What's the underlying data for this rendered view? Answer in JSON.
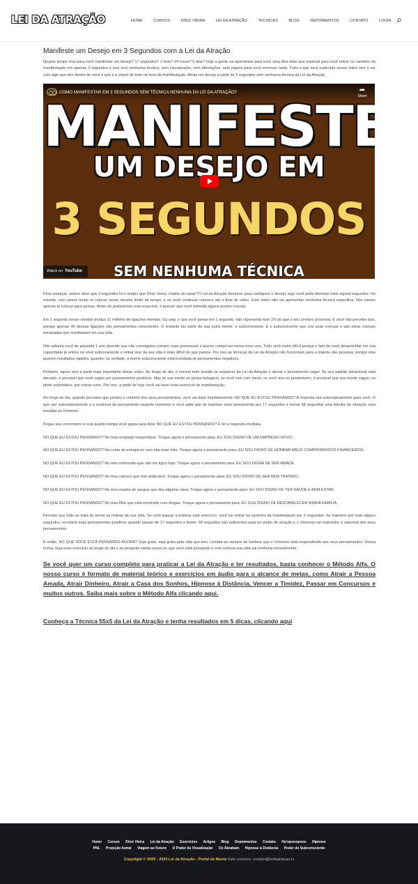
{
  "header": {
    "logo": "LEI DA ATRAÇÃO",
    "nav": [
      "Home",
      "CURSOS",
      "DINIZ VIEIRA",
      "LEI DA ATRAÇÃO",
      "TECNICAS",
      "BLOG",
      "DEPOIMENTOS",
      "CONTATO",
      "LOGIN"
    ]
  },
  "post": {
    "title": "Manifeste um Desejo em 3 Segundos com a Lei da Atração",
    "intro": "Quanto tempo leva para você manifestar um desejo? 17 segundos? 1 hora? 24 horas? 5 dias? Hoje a gente vai apresentar para você uma dica mais que especial para você entrar no caminho da manifestação em apenas 3 segundos e isso sem nenhuma técnica, sem visualização, sem afirmações, sem papeis para você escrever nada. Tudo o que será explicado nesse vídeo tem a ver com algo que tem dentro de você e que é a chave de tudo na hora da manifestação. Atraia um desejo a partir de 3 segundos sem nenhuma técnica da Lei da Atração.",
    "video": {
      "title": "COMO MANIFESTAR EM 3 SEGUNDOS SEM TÉCNICA NENHUMA DA LEI DA ATRAÇÃO?",
      "share_label": "Share",
      "thumb_line1": "MANIFESTE",
      "thumb_line2": "UM DESEJO EM",
      "thumb_line3": "3 SEGUNDOS",
      "thumb_line4": "SEM NENHUMA TÉCNICA",
      "watch_on": "Watch on",
      "youtube": "YouTube"
    },
    "paragraphs": [
      "Para começar, vamos dizer que 3 segundos foi o tempo que Diniz Vieira, criador do canal TV Lei da Atração demorou para configurar o desejo, logo você pode demorar mais alguns segundos. No entanto, nós vamos tentar te colocar nesse mesmo limite de tempo, e só você continuar conosco até o final do vídeo. Este vídeo não vai apresentar nenhuma técnica especifica. Nós vamos apenas te colocar para pensar. Antes de praticarmos este exercício, é preciso que você entenda alguns pontos cruciais.",
      "Em 1 segundo nosso cérebro produz 11 milhões de ligações mentais. Ou seja, o que você pensa em 1 segundo, não representa nem 1% do que o seu cérebro processa. E você não percebe isso, porque apenas 40 dessas ligações são pensamentos conscientes. O restante faz parte da sua outra mente: o subconsciente. É o subconsciente que cria suas crenças e são estas crenças enraizadas que manifestam em sua vida.",
      "Não adianta você ter passado 1 ano dizendo que não conseguiria cumprir suas promessas e querer cumpri-las nesse novo ano. Tudo será muito difícil porque o fato de você desacreditar em sua capacidade já entrou no nível subconsciente e retirar isso da sua vida é mais difícil do que parece. Por isso as técnicas da Lei da Atração não funcionam para a maioria das pessoas, porque elas querem resultados rápidos, quando, na verdade, a mente subconsciente está inundada de pensamentos negativos.",
      "Portanto, agora vem a parte mais importante desse vídeo. Ao longo do dia, é normal todo mundo se esquecer da Lei da Atração e deixar o pensamento vagar. Se seu padrão vibracional está elevado, é provável que você vague por pensamentos positivos. Mas se sua mente só pensa bobagem, se você vive com medo, se você vive no pessimismo, é provável que sua mente vague, no piloto automático, por coisas ruins. Por isso, a partir de hoje você vai fazer esse exercício de manifestação:",
      "Ao longo do dia, quando perceber que perdeu o controlo dos seus pensamentos, você vai dizer imediatamente: NO QUE EU ESTOU PENSANDO? A resposta virá automaticamente para você. O que vier automaticamente é a essência do pensamento naquele momento e você sabe que se mantiver esse pensamento por 17 segundos e somar 68 segundos uma bomba de vibração será enviada ao Universo.",
      "Pegue seu cronometro e veja quanto tempo você gasta para dizer NO QUE EU ESTOU PENSANDO? E ter a resposta imediata.",
      "NO QUE EU ESTOU PENSANDO? No meu emprego insuportável. Troque agora o pensamento para: EU SOU DIGNO DE UM EMPREGO NOVO.",
      "NO QUE EU ESTOU PENSANDO? Na conta de energia eu veio alta esse mês. Troque agora o pensamento para: EU SOU DIGNO DE HONRAR MEUS COMPROMISSOS FINANCEIROS.",
      "NO QUE EU ESTOU PENSANDO? No meu namorado que não me ligou hoje. Troque agora o pensamento para: EU SOU DIGNA DE SER AMADA.",
      "NO QUE EU ESTOU PENSANDO? No meu namoro que não anda bem. Troque agora o pensamento para: EU SOU DIGNO DE SER BEM TRATADO.",
      "NO QUE EU ESTOU PENSANDO? No meu exame de sangue que deu alguma coisa. Troque agora o pensamento para: EU SOU DIGNO DE TER SAÚDE E BEM-ESTAR.",
      "NO QUE EU ESTOU PENSANDO? No meu filho que está envolvido com drogas. Troque agora o pensamento para: EU SOU DIGNO DE RESTABELECER MINHA FAMÍLIA.",
      "Percebe que tudo se trata de tomar as rédeas da sua vida. Se você passar a praticar este exercício, você vai entrar no caminho da manifestação por 3 segundos. Se mantiver por mais alguns segundos, receberá mais pensamentos positivos quando passar de 17 segundos e boom: 68 segundos são suficientes para ter poder de atração e o Universo vai responder à natureza dos seus pensamentos.",
      "E então, NO QUE VOCÊ ESTÁ PENSANDO AGORA? Seja grato, seja grata pela vida que tem. Lembre-se sempre de lembrar que o Universo está respondendo aos seus pensamentos. Dessa forma, faça esse exercício ao longo do dia e se pergunte várias vezes no que você está pensando e com certeza sua vida vai melhorar incrivelmente."
    ],
    "cta1": "Se você quer um curso completo para praticar a Lei da Atração e ter resultados, basta conhecer o Método Alfa. O nosso curso é formato de material teórico e exercícios em áudio para o alcance de metas, como Atrair a Pessoa Amada, Atrair Dinheiro, Atrair a Casa dos Sonhos, Hipnose à Distância, Vencer a Timidez, Passar em Concursos e muitos outros. Saiba mais sobre o Método Alfa clicando aqui.",
    "cta2": "Conheça a Técnica 55x5 da Lei da Atração e tenha resultados em 5 dicas, clicando aqui"
  },
  "footer": {
    "nav_row1": [
      "Home",
      "Cursos",
      "Diniz Vieira",
      "Lei da Atração",
      "Exercícios",
      "Artigos",
      "Blog",
      "Depoimentos",
      "Contato",
      "Ho'oponopono",
      "Hipnose"
    ],
    "nav_row2": [
      "PNL",
      "Projeção Astral",
      "Viagem ao Futuro",
      "O Poder da Visualização",
      "Os Abraham",
      "Hipnose à Distância",
      "Poder do Subconsciente"
    ],
    "copyright": "Copyright © 2009 - 2024 Lei da Atração - Portal da Mente",
    "contact": "Fale conosco: contato@leidaatracao.tv"
  },
  "colors": {
    "footer_bg": "#17181c",
    "copyright": "#e3c93b",
    "video_bg": "#5a2e0c",
    "play_button": "#ff0000"
  }
}
